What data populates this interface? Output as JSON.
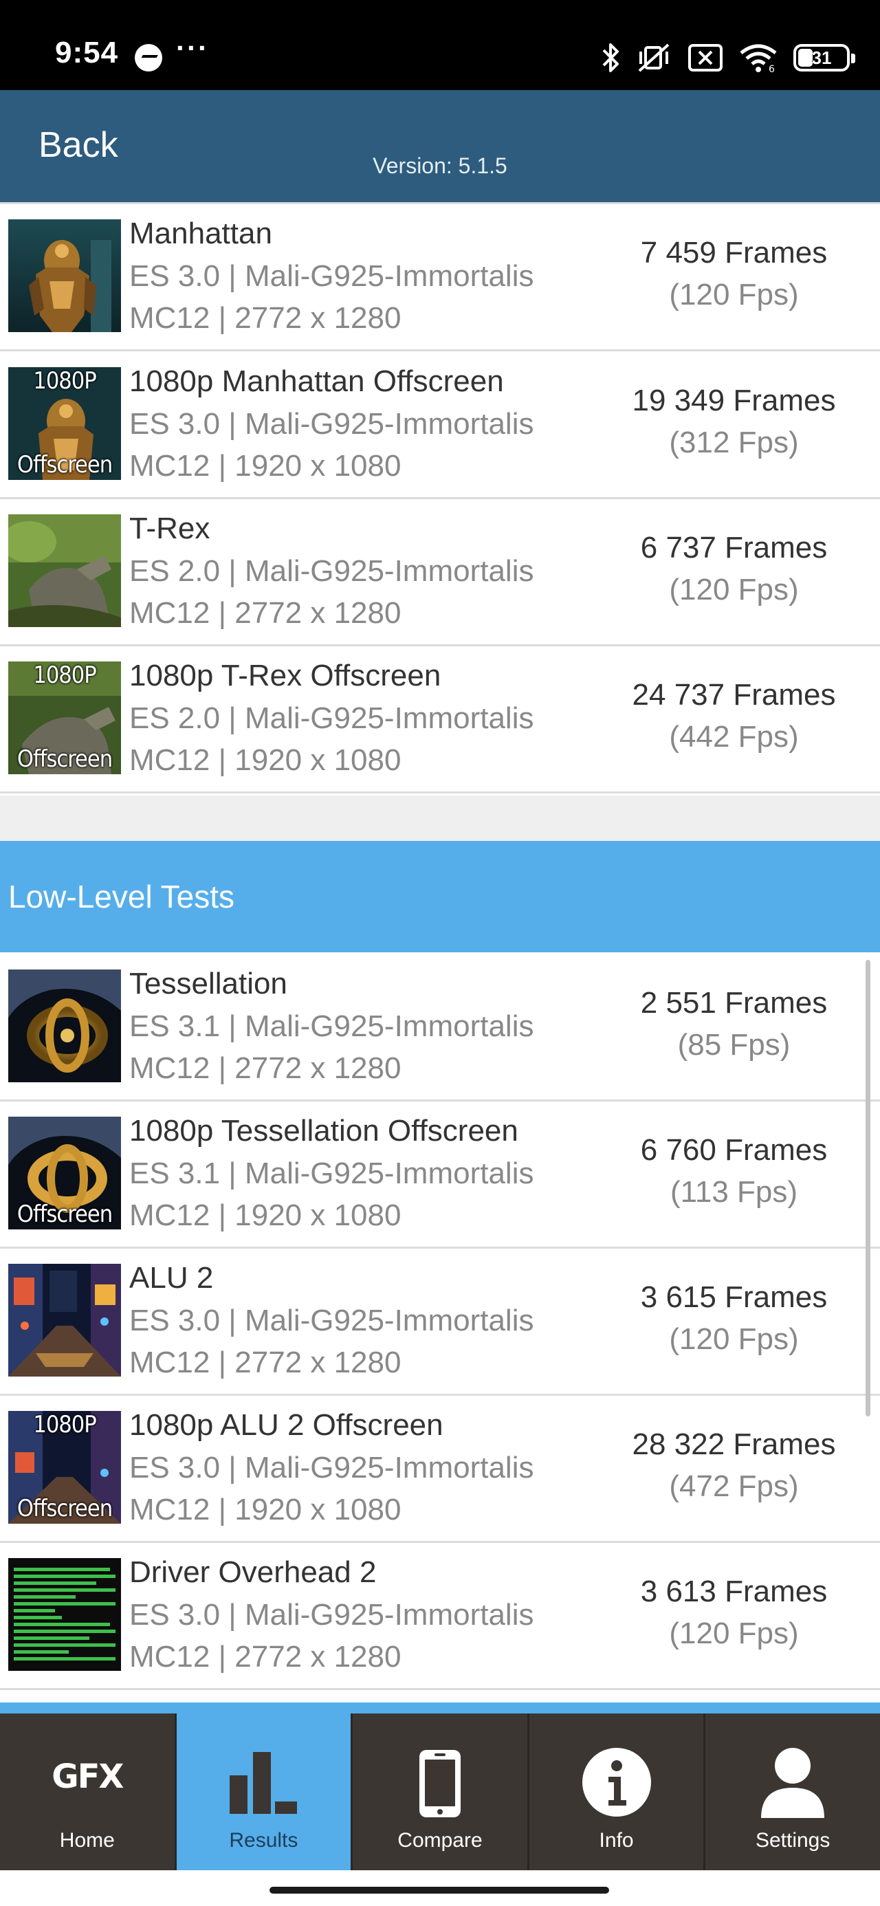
{
  "status_bar": {
    "time": "9:54",
    "dots": "···",
    "battery": "31",
    "battery_level": 0.31,
    "icons": [
      "messenger-icon",
      "bluetooth-icon",
      "vibrate-off-icon",
      "no-sim-icon",
      "wifi-icon",
      "battery-icon"
    ]
  },
  "header": {
    "back_label": "Back",
    "version": "Version: 5.1.5",
    "color": "#2e5c7e"
  },
  "high_level_rows": [
    {
      "name": "Manhattan",
      "spec": "ES 3.0 | Mali-G925-Immortalis",
      "res": "MC12 | 2772 x 1280",
      "frames": "7 459 Frames",
      "fps": "(120 Fps)",
      "thumb": "manhattan-thumbnail",
      "tag_top": "",
      "tag_bottom": ""
    },
    {
      "name": "1080p Manhattan Offscreen",
      "spec": "ES 3.0 | Mali-G925-Immortalis",
      "res": "MC12 | 1920 x 1080",
      "frames": "19 349 Frames",
      "fps": "(312 Fps)",
      "thumb": "manhattan-offscreen-thumbnail",
      "tag_top": "1080P",
      "tag_bottom": "Offscreen"
    },
    {
      "name": "T-Rex",
      "spec": "ES 2.0 | Mali-G925-Immortalis",
      "res": "MC12 | 2772 x 1280",
      "frames": "6 737 Frames",
      "fps": "(120 Fps)",
      "thumb": "trex-thumbnail",
      "tag_top": "",
      "tag_bottom": ""
    },
    {
      "name": "1080p T-Rex Offscreen",
      "spec": "ES 2.0 | Mali-G925-Immortalis",
      "res": "MC12 | 1920 x 1080",
      "frames": "24 737 Frames",
      "fps": "(442 Fps)",
      "thumb": "trex-offscreen-thumbnail",
      "tag_top": "1080P",
      "tag_bottom": "Offscreen"
    }
  ],
  "section": {
    "title": "Low-Level Tests",
    "color": "#55aeea"
  },
  "low_level_rows": [
    {
      "name": "Tessellation",
      "spec": "ES 3.1 | Mali-G925-Immortalis",
      "res": "MC12 | 2772 x 1280",
      "frames": "2 551 Frames",
      "fps": "(85 Fps)",
      "thumb": "tessellation-thumbnail",
      "tag_top": "",
      "tag_bottom": ""
    },
    {
      "name": "1080p Tessellation Offscreen",
      "spec": "ES 3.1 | Mali-G925-Immortalis",
      "res": "MC12 | 1920 x 1080",
      "frames": "6 760 Frames",
      "fps": "(113 Fps)",
      "thumb": "tessellation-offscreen-thumbnail",
      "tag_top": "",
      "tag_bottom": "Offscreen"
    },
    {
      "name": "ALU 2",
      "spec": "ES 3.0 | Mali-G925-Immortalis",
      "res": "MC12 | 2772 x 1280",
      "frames": "3 615 Frames",
      "fps": "(120 Fps)",
      "thumb": "alu2-thumbnail",
      "tag_top": "",
      "tag_bottom": ""
    },
    {
      "name": "1080p ALU 2 Offscreen",
      "spec": "ES 3.0 | Mali-G925-Immortalis",
      "res": "MC12 | 1920 x 1080",
      "frames": "28 322 Frames",
      "fps": "(472 Fps)",
      "thumb": "alu2-offscreen-thumbnail",
      "tag_top": "1080P",
      "tag_bottom": "Offscreen"
    },
    {
      "name": "Driver Overhead 2",
      "spec": "ES 3.0 | Mali-G925-Immortalis",
      "res": "MC12 | 2772 x 1280",
      "frames": "3 613 Frames",
      "fps": "(120 Fps)",
      "thumb": "driver-overhead-thumbnail",
      "tag_top": "",
      "tag_bottom": ""
    }
  ],
  "bottom_nav": {
    "active_color": "#55aeea",
    "items": [
      {
        "label": "Home",
        "icon": "gfx-logo-icon",
        "logo_text": "GFX"
      },
      {
        "label": "Results",
        "icon": "bar-chart-icon"
      },
      {
        "label": "Compare",
        "icon": "phone-icon"
      },
      {
        "label": "Info",
        "icon": "info-icon"
      },
      {
        "label": "Settings",
        "icon": "user-icon"
      }
    ]
  }
}
